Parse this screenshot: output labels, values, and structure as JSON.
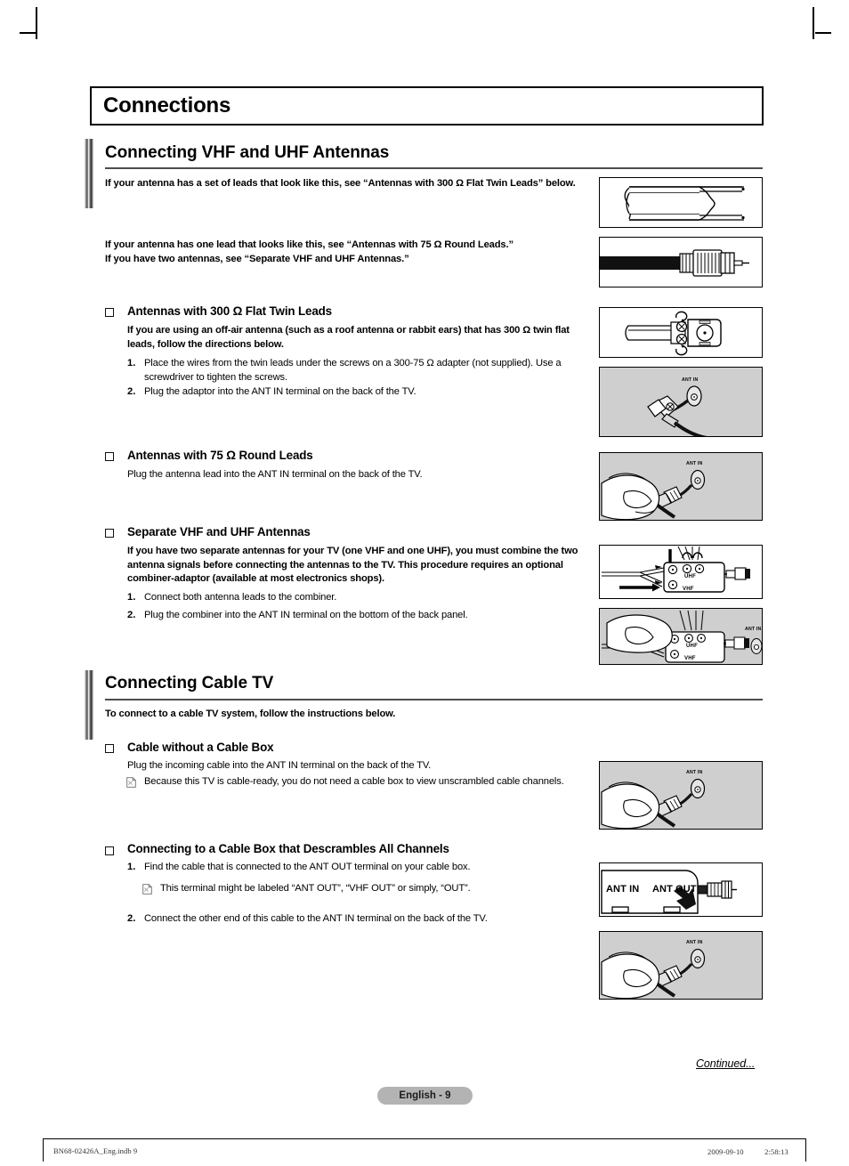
{
  "chapter": {
    "title": "Connections"
  },
  "sections": [
    {
      "heading": "Connecting VHF and UHF Antennas",
      "intro1": "If your antenna has a set of leads that look like this, see “Antennas with 300 Ω Flat Twin Leads” below.",
      "intro2_line1": "If your antenna has one lead that looks like this, see “Antennas with 75 Ω Round Leads.”",
      "intro2_line2": "If you have two antennas, see “Separate VHF and UHF Antennas.”",
      "subsections": [
        {
          "title": "Antennas with 300 Ω Flat Twin Leads",
          "lead": "If you are using an off-air antenna (such as a roof antenna or rabbit ears) that has 300 Ω twin flat leads, follow the directions below.",
          "steps": [
            {
              "num": "1.",
              "text": "Place the wires from the twin leads under the screws on a 300-75 Ω adapter (not supplied). Use a screwdriver to tighten the screws."
            },
            {
              "num": "2.",
              "text": "Plug the adaptor into the ANT IN terminal on the back of the TV."
            }
          ]
        },
        {
          "title": "Antennas with 75 Ω Round Leads",
          "lead": "Plug the antenna lead into the ANT IN terminal on the back of the TV.",
          "steps": []
        },
        {
          "title": "Separate VHF and UHF Antennas",
          "lead": "If you have two separate antennas for your TV (one VHF and one UHF), you must combine the two antenna signals before connecting the antennas to the TV. This procedure requires an optional combiner-adaptor (available at most electronics shops).",
          "steps": [
            {
              "num": "1.",
              "text": "Connect both antenna leads to the combiner."
            },
            {
              "num": "2.",
              "text": "Plug the combiner into the ANT IN terminal on the bottom of the back panel."
            }
          ]
        }
      ]
    },
    {
      "heading": "Connecting Cable TV",
      "intro1": "To connect to a cable TV system, follow the instructions below.",
      "subsections": [
        {
          "title": "Cable without a Cable Box",
          "lead": "Plug the incoming cable into the ANT IN terminal on the back of the TV.",
          "note": "Because this TV is cable-ready, you do not need a cable box to view unscrambled cable channels."
        },
        {
          "title": "Connecting to a Cable Box that Descrambles All Channels",
          "steps": [
            {
              "num": "1.",
              "text": "Find the cable that is connected to the ANT OUT terminal on your cable box."
            },
            {
              "num": "2.",
              "text": "Connect the other end of this cable to the ANT IN terminal on the back of the TV."
            }
          ],
          "note": "This terminal might be labeled “ANT OUT”, “VHF OUT” or simply, “OUT”."
        }
      ]
    }
  ],
  "figures": {
    "flat_twin_leads": {
      "name": "flat-twin-lead-cable"
    },
    "round_lead": {
      "name": "round-lead-coax-connector"
    },
    "adapter_300_75": {
      "name": "300-75-ohm-adapter"
    },
    "ant_in_adapter": {
      "label": "ANT IN"
    },
    "ant_in_hand_round": {
      "label": "ANT IN"
    },
    "combiner": {
      "uhf": "UHF",
      "vhf": "VHF"
    },
    "combiner_hand": {
      "uhf": "UHF",
      "vhf": "VHF",
      "label": "ANT IN"
    },
    "ant_in_hand_cable": {
      "label": "ANT IN"
    },
    "cable_box": {
      "ant_in": "ANT IN",
      "ant_out": "ANT OUT"
    },
    "ant_in_hand_cable2": {
      "label": "ANT IN"
    }
  },
  "footer": {
    "continued": "Continued...",
    "page_label": "English - 9",
    "imprint_left": "BN68-02426A_Eng.indb   9",
    "imprint_date": "2009-09-10",
    "imprint_tofu": "　　",
    "imprint_time": "2:58:13"
  },
  "colors": {
    "figure_gray": "#cfcfcf",
    "rule_gray": "#4d4d4d",
    "pill_gray": "#b3b3b3"
  }
}
